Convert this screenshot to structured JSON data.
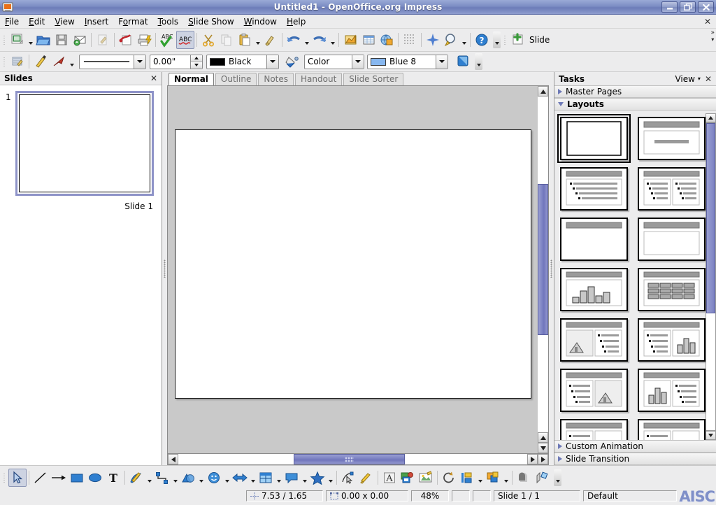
{
  "window": {
    "title": "Untitled1 - OpenOffice.org Impress",
    "app_icon": "impress-icon",
    "buttons": [
      {
        "name": "minimize-button",
        "glyph": "minimize-icon"
      },
      {
        "name": "restore-button",
        "glyph": "restore-icon"
      },
      {
        "name": "close-button",
        "glyph": "close-icon"
      }
    ]
  },
  "menubar": {
    "items": [
      {
        "label": "File",
        "accel": "F"
      },
      {
        "label": "Edit",
        "accel": "E"
      },
      {
        "label": "View",
        "accel": "V"
      },
      {
        "label": "Insert",
        "accel": "I"
      },
      {
        "label": "Format",
        "accel": "o"
      },
      {
        "label": "Tools",
        "accel": "T"
      },
      {
        "label": "Slide Show",
        "accel": "S"
      },
      {
        "label": "Window",
        "accel": "W"
      },
      {
        "label": "Help",
        "accel": "H"
      }
    ],
    "close_label": "✕"
  },
  "standard_toolbar": {
    "items": [
      {
        "name": "new-document-button",
        "icon": "new-document-icon",
        "dropdown": true
      },
      {
        "name": "open-button",
        "icon": "folder-open-icon"
      },
      {
        "name": "save-button",
        "icon": "save-icon"
      },
      {
        "name": "email-document-button",
        "icon": "envelope-icon"
      },
      {
        "name": "edit-file-button",
        "icon": "edit-file-icon"
      },
      {
        "name": "export-pdf-button",
        "icon": "pdf-icon"
      },
      {
        "name": "print-button",
        "icon": "printer-icon"
      },
      {
        "name": "spelling-button",
        "icon": "abc-check-icon"
      },
      {
        "name": "autospellcheck-button",
        "icon": "abc-underline-icon",
        "active": true
      },
      {
        "name": "cut-button",
        "icon": "scissors-icon"
      },
      {
        "name": "copy-button",
        "icon": "copy-icon"
      },
      {
        "name": "paste-button",
        "icon": "clipboard-icon",
        "dropdown": true
      },
      {
        "name": "clone-formatting-button",
        "icon": "paintbrush-icon"
      },
      {
        "name": "undo-button",
        "icon": "undo-arrow-icon",
        "dropdown": true
      },
      {
        "name": "redo-button",
        "icon": "redo-arrow-icon",
        "dropdown": true
      },
      {
        "name": "insert-chart-button",
        "icon": "chart-icon"
      },
      {
        "name": "insert-table-button",
        "icon": "table-icon"
      },
      {
        "name": "hyperlink-button",
        "icon": "hyperlink-icon"
      },
      {
        "name": "display-grid-button",
        "icon": "grid-icon"
      },
      {
        "name": "show-draw-functions-button",
        "icon": "sparkle-icon"
      },
      {
        "name": "zoom-button",
        "icon": "magnifier-icon",
        "dropdown": true
      },
      {
        "name": "help-button",
        "icon": "help-circle-icon"
      }
    ],
    "new_slide": {
      "label": "Slide",
      "icon": "new-slide-icon"
    },
    "overflow_label": "»"
  },
  "line_toolbar": {
    "items": [
      {
        "name": "position-size-button",
        "icon": "position-size-icon"
      },
      {
        "name": "line-button",
        "icon": "pen-icon"
      },
      {
        "name": "arrow-style-button",
        "icon": "arrow-head-icon",
        "dropdown": true
      }
    ],
    "line_style": {
      "label": "",
      "name": "line-style-combo"
    },
    "line_width": {
      "value": "0.00\"",
      "name": "line-width-spinner"
    },
    "line_color": {
      "value": "Black",
      "swatch": "#000000",
      "name": "line-color-combo"
    },
    "fill_button": {
      "name": "area-style-button",
      "icon": "fill-bucket-icon"
    },
    "fill_style": {
      "value": "Color",
      "name": "fill-style-combo"
    },
    "fill_color": {
      "value": "Blue 8",
      "swatch": "#87b7ef",
      "name": "fill-color-combo"
    },
    "shadow_button": {
      "name": "shadow-button",
      "icon": "shadow-icon"
    }
  },
  "slides_panel": {
    "title": "Slides",
    "close_label": "✕",
    "slides": [
      {
        "number": "1",
        "caption": "Slide 1",
        "selected": true
      }
    ]
  },
  "view_tabs": {
    "tabs": [
      {
        "label": "Normal",
        "active": true
      },
      {
        "label": "Outline",
        "active": false
      },
      {
        "label": "Notes",
        "active": false
      },
      {
        "label": "Handout",
        "active": false
      },
      {
        "label": "Slide Sorter",
        "active": false
      }
    ]
  },
  "tasks_panel": {
    "title": "Tasks",
    "view_label": "View",
    "close_label": "✕",
    "sections": [
      {
        "label": "Master Pages",
        "expanded": false
      },
      {
        "label": "Layouts",
        "expanded": true
      },
      {
        "label": "Custom Animation",
        "expanded": false
      },
      {
        "label": "Slide Transition",
        "expanded": false
      }
    ],
    "layouts": [
      {
        "name": "layout-blank",
        "kind": "blank",
        "selected": true
      },
      {
        "name": "layout-title-content-only",
        "kind": "title-subtitle",
        "selected": false
      },
      {
        "name": "layout-title-content",
        "kind": "title-bullets",
        "selected": false
      },
      {
        "name": "layout-title-two-content",
        "kind": "title-two-bullets",
        "selected": false
      },
      {
        "name": "layout-title-only",
        "kind": "title-only",
        "selected": false
      },
      {
        "name": "layout-title-box",
        "kind": "title-box",
        "selected": false
      },
      {
        "name": "layout-title-chart",
        "kind": "title-chart",
        "selected": false
      },
      {
        "name": "layout-title-table",
        "kind": "title-table",
        "selected": false
      },
      {
        "name": "layout-title-clipart-content",
        "kind": "title-image-bullets",
        "selected": false
      },
      {
        "name": "layout-title-content-chart",
        "kind": "title-bullets-chart",
        "selected": false
      },
      {
        "name": "layout-title-content-clipart",
        "kind": "title-bullets-image",
        "selected": false
      },
      {
        "name": "layout-title-chart-content",
        "kind": "title-chart-bullets",
        "selected": false
      },
      {
        "name": "layout-title-content-box",
        "kind": "title-bullets-box",
        "selected": false
      },
      {
        "name": "layout-title-content-boxes",
        "kind": "title-bullets-boxes",
        "selected": false
      }
    ]
  },
  "drawing_toolbar": {
    "items": [
      {
        "name": "select-tool",
        "icon": "arrow-cursor-icon",
        "active": true
      },
      {
        "name": "line-tool",
        "icon": "line-icon"
      },
      {
        "name": "arrow-tool",
        "icon": "arrow-line-icon"
      },
      {
        "name": "rectangle-tool",
        "icon": "rectangle-icon"
      },
      {
        "name": "ellipse-tool",
        "icon": "ellipse-icon"
      },
      {
        "name": "text-tool",
        "icon": "text-T-icon"
      },
      {
        "name": "curve-tool",
        "icon": "curve-pencil-icon",
        "dropdown": true
      },
      {
        "name": "connector-tool",
        "icon": "connector-icon",
        "dropdown": true
      },
      {
        "name": "basic-shapes-tool",
        "icon": "basic-shapes-icon",
        "dropdown": true
      },
      {
        "name": "symbol-shapes-tool",
        "icon": "smiley-icon",
        "dropdown": true
      },
      {
        "name": "block-arrows-tool",
        "icon": "block-arrow-icon",
        "dropdown": true
      },
      {
        "name": "flowchart-tool",
        "icon": "flowchart-icon",
        "dropdown": true
      },
      {
        "name": "callouts-tool",
        "icon": "callout-icon",
        "dropdown": true
      },
      {
        "name": "stars-tool",
        "icon": "star-icon",
        "dropdown": true
      },
      {
        "name": "points-tool",
        "icon": "edit-points-icon"
      },
      {
        "name": "glue-points-tool",
        "icon": "glue-points-icon"
      },
      {
        "name": "fontwork-tool",
        "icon": "fontwork-A-icon"
      },
      {
        "name": "from-file-tool",
        "icon": "insert-image-icon"
      },
      {
        "name": "gallery-tool",
        "icon": "gallery-icon"
      },
      {
        "name": "image-edit-tool",
        "icon": "picture-edit-icon"
      },
      {
        "name": "rotate-tool",
        "icon": "rotate-icon"
      },
      {
        "name": "alignment-tool",
        "icon": "align-icon",
        "dropdown": true
      },
      {
        "name": "arrange-tool",
        "icon": "arrange-icon",
        "dropdown": true
      },
      {
        "name": "shadow-tool",
        "icon": "shadow-square-icon"
      },
      {
        "name": "crop-tool",
        "icon": "filter-icon"
      }
    ]
  },
  "statusbar": {
    "cursor_position": "7.53 / 1.65",
    "object_size": "0.00 x 0.00",
    "zoom": "48%",
    "slide_indicator": "Slide 1 / 1",
    "master": "Default",
    "logo": "AISC"
  }
}
